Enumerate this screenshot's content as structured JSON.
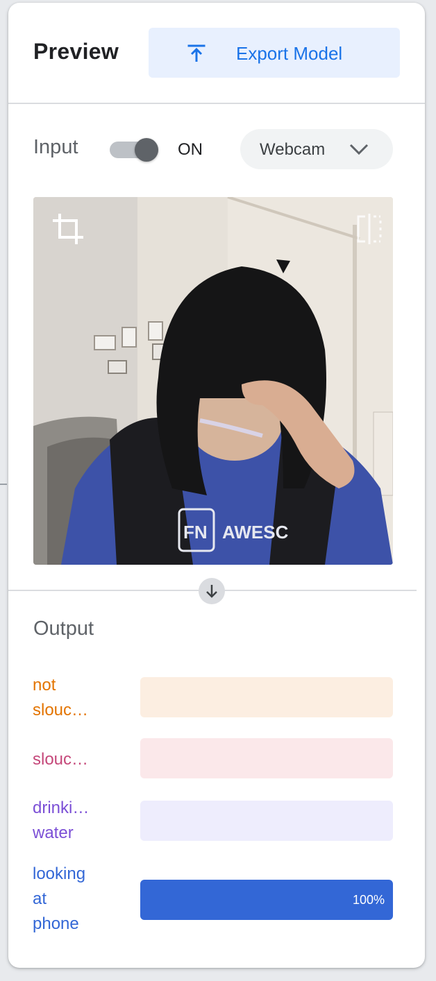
{
  "header": {
    "title": "Preview",
    "export_label": "Export Model"
  },
  "input": {
    "label": "Input",
    "toggle_state": "ON",
    "source": "Webcam"
  },
  "output": {
    "title": "Output",
    "classes": [
      {
        "label": "not\nslouc…",
        "color": "#e37400",
        "bg": "#fceee1",
        "fill_color": "#e37400",
        "confidence": 0,
        "pct_text": ""
      },
      {
        "label": "slouc…",
        "color": "#c5487a",
        "bg": "#fbe8ea",
        "fill_color": "#c5487a",
        "confidence": 0,
        "pct_text": ""
      },
      {
        "label": "drinki…\nwater",
        "color": "#7b4fd6",
        "bg": "#eeedfd",
        "fill_color": "#7b4fd6",
        "confidence": 0,
        "pct_text": ""
      },
      {
        "label": "looking\nat\nphone",
        "color": "#3367d6",
        "bg": "#e8f0fe",
        "fill_color": "#3367d6",
        "confidence": 1.0,
        "pct_text": "100%"
      }
    ]
  },
  "icons": {
    "export": "upload-arrow-icon",
    "dropdown": "chevron-down-icon",
    "crop": "crop-icon",
    "flip": "flip-icon",
    "arrow": "arrow-down-icon"
  }
}
